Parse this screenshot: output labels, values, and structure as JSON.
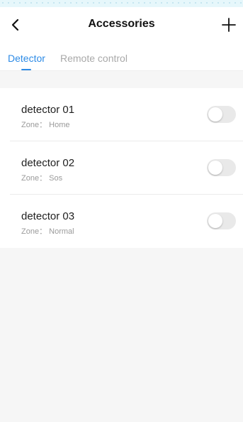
{
  "header": {
    "title": "Accessories",
    "back_icon": "chevron-left-icon",
    "add_icon": "plus-icon"
  },
  "tabs": [
    {
      "label": "Detector",
      "active": true
    },
    {
      "label": "Remote control",
      "active": false
    }
  ],
  "detectors": [
    {
      "name": "detector 01",
      "zone": "Zone： Home",
      "enabled": false
    },
    {
      "name": "detector 02",
      "zone": "Zone： Sos",
      "enabled": false
    },
    {
      "name": "detector 03",
      "zone": "Zone： Normal",
      "enabled": false
    }
  ],
  "colors": {
    "accent": "#2d8be6",
    "background": "#f6f6f6",
    "card": "#ffffff",
    "toggle_off": "#e9e9e9"
  }
}
